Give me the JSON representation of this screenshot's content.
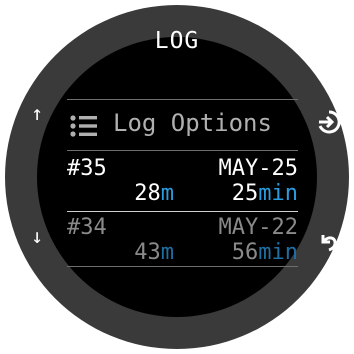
{
  "screen": {
    "title": "LOG"
  },
  "side_buttons": {
    "up": "↑",
    "down": "↓"
  },
  "menu": {
    "label": "Log Options",
    "icon": "list-icon"
  },
  "entries": [
    {
      "number": "#35",
      "date": "MAY-25",
      "depth": "28",
      "depth_unit": "m",
      "time": "25",
      "time_unit": "min",
      "selected": true
    },
    {
      "number": "#34",
      "date": "MAY-22",
      "depth": "43",
      "depth_unit": "m",
      "time": "56",
      "time_unit": "min",
      "selected": false
    }
  ],
  "colors": {
    "accent": "#2a9de0",
    "background": "#000000",
    "bezel": "#3a3a3a"
  }
}
